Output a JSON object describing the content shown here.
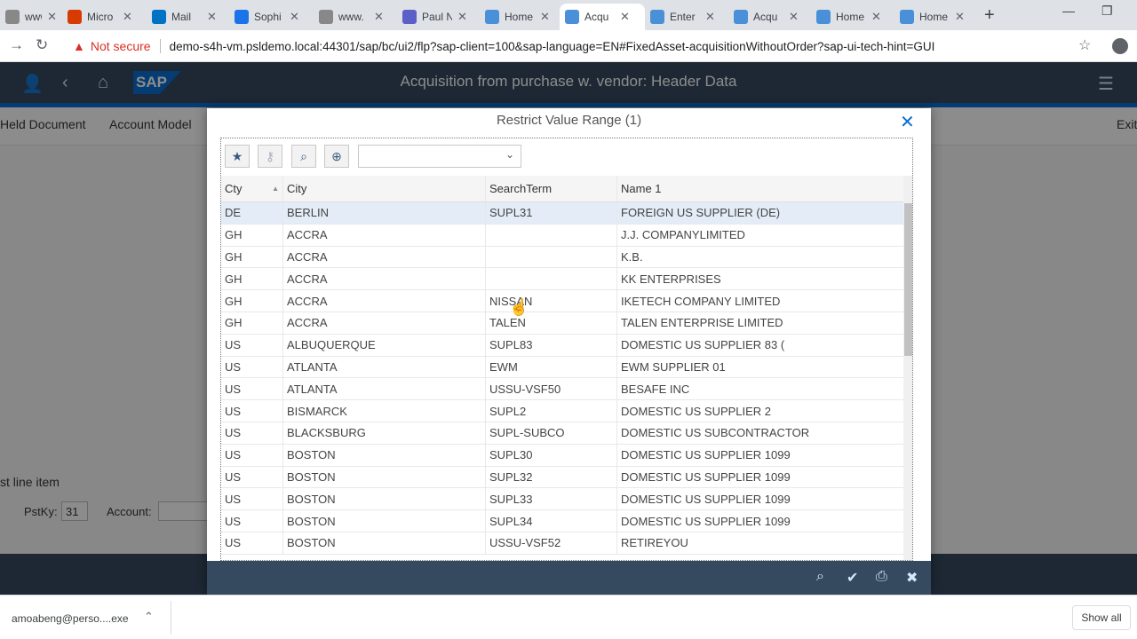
{
  "browser": {
    "tabs": [
      {
        "title": "www.",
        "icon": "globe-icon",
        "color": "#888888",
        "active": false
      },
      {
        "title": "Micro",
        "icon": "office-icon",
        "color": "#d83b01",
        "active": false
      },
      {
        "title": "Mail",
        "icon": "outlook-icon",
        "color": "#0072c6",
        "active": false
      },
      {
        "title": "Sophi",
        "icon": "s-icon",
        "color": "#1a73e8",
        "active": false
      },
      {
        "title": "www.",
        "icon": "globe-icon",
        "color": "#888888",
        "active": false
      },
      {
        "title": "Paul N",
        "icon": "teams-icon",
        "color": "#5b5fc7",
        "active": false
      },
      {
        "title": "Home",
        "icon": "sap-icon",
        "color": "#4a90d9",
        "active": false
      },
      {
        "title": "Acqu",
        "icon": "sap-icon",
        "color": "#4a90d9",
        "active": true
      },
      {
        "title": "Enter",
        "icon": "sap-icon",
        "color": "#4a90d9",
        "active": false
      },
      {
        "title": "Acqu",
        "icon": "sap-icon",
        "color": "#4a90d9",
        "active": false
      },
      {
        "title": "Home",
        "icon": "sap-icon",
        "color": "#4a90d9",
        "active": false
      },
      {
        "title": "Home",
        "icon": "sap-icon",
        "color": "#4a90d9",
        "active": false
      }
    ],
    "not_secure": "Not secure",
    "url": "demo-s4h-vm.psldemo.local:44301/sap/bc/ui2/flp?sap-client=100&sap-language=EN#FixedAsset-acquisitionWithoutOrder?sap-ui-tech-hint=GUI"
  },
  "shell": {
    "logo": "SAP",
    "title": "Acquisition from purchase w. vendor: Header Data",
    "dots": "....",
    "accent_color": "#0a6ed1",
    "bar_color": "#354a5f"
  },
  "app_toolbar": {
    "held_document": "Held Document",
    "account_model": "Account Model",
    "exit": "Exit"
  },
  "app_body": {
    "line_item_label": "st line item",
    "pstky_label": "PstKy:",
    "pstky_value": "31",
    "account_label": "Account:"
  },
  "dialog": {
    "title": "Restrict Value Range (1)",
    "toolbar_select_value": "",
    "columns": [
      "Cty",
      "City",
      "SearchTerm",
      "Name 1"
    ],
    "rows": [
      {
        "cty": "DE",
        "city": "BERLIN",
        "search": "SUPL31",
        "name": "FOREIGN US SUPPLIER (DE)"
      },
      {
        "cty": "GH",
        "city": "ACCRA",
        "search": "",
        "name": "J.J. COMPANYLIMITED"
      },
      {
        "cty": "GH",
        "city": "ACCRA",
        "search": "",
        "name": "K.B."
      },
      {
        "cty": "GH",
        "city": "ACCRA",
        "search": "",
        "name": "KK ENTERPRISES"
      },
      {
        "cty": "GH",
        "city": "ACCRA",
        "search": "NISSAN",
        "name": "IKETECH COMPANY LIMITED"
      },
      {
        "cty": "GH",
        "city": "ACCRA",
        "search": "TALEN",
        "name": "TALEN ENTERPRISE LIMITED"
      },
      {
        "cty": "US",
        "city": "ALBUQUERQUE",
        "search": "SUPL83",
        "name": "DOMESTIC US SUPPLIER 83 ("
      },
      {
        "cty": "US",
        "city": "ATLANTA",
        "search": "EWM",
        "name": "EWM SUPPLIER 01"
      },
      {
        "cty": "US",
        "city": "ATLANTA",
        "search": "USSU-VSF50",
        "name": "BESAFE INC"
      },
      {
        "cty": "US",
        "city": "BISMARCK",
        "search": "SUPL2",
        "name": "DOMESTIC US SUPPLIER 2"
      },
      {
        "cty": "US",
        "city": "BLACKSBURG",
        "search": "SUPL-SUBCO",
        "name": "DOMESTIC US SUBCONTRACTOR"
      },
      {
        "cty": "US",
        "city": "BOSTON",
        "search": "SUPL30",
        "name": "DOMESTIC US SUPPLIER 1099"
      },
      {
        "cty": "US",
        "city": "BOSTON",
        "search": "SUPL32",
        "name": "DOMESTIC US SUPPLIER 1099"
      },
      {
        "cty": "US",
        "city": "BOSTON",
        "search": "SUPL33",
        "name": "DOMESTIC US SUPPLIER 1099"
      },
      {
        "cty": "US",
        "city": "BOSTON",
        "search": "SUPL34",
        "name": "DOMESTIC US SUPPLIER 1099"
      },
      {
        "cty": "US",
        "city": "BOSTON",
        "search": "USSU-VSF52",
        "name": "RETIREYOU"
      }
    ]
  },
  "download_bar": {
    "file": "amoabeng@perso....exe",
    "show_all": "Show all"
  }
}
